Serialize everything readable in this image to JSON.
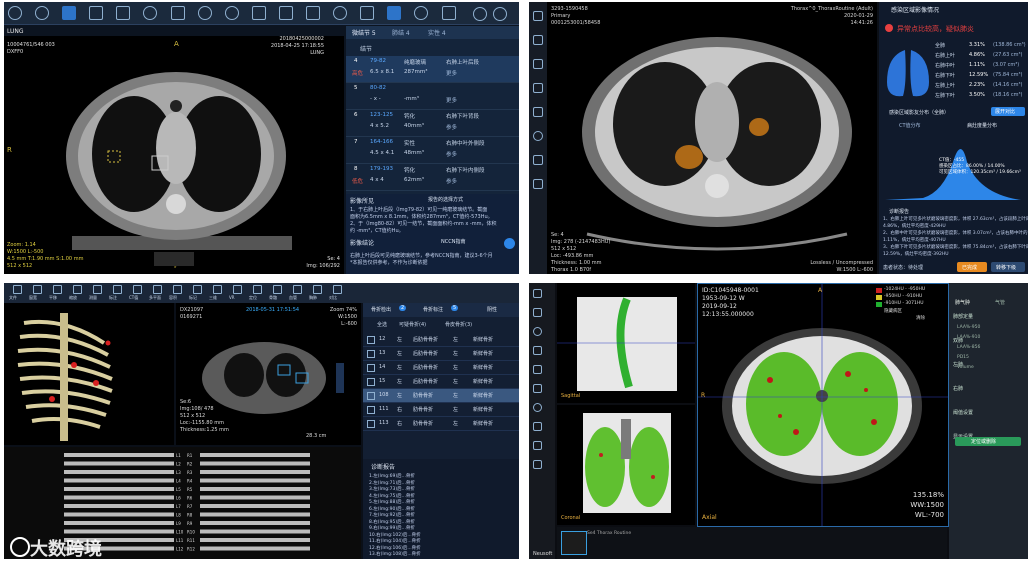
{
  "q1": {
    "patient_name": "LUNG",
    "info_left": [
      "10004761/546 003",
      "DXFF0"
    ],
    "info_right": [
      "20180425000002",
      "2018-04-25 17:18:55",
      "LUNG"
    ],
    "view_label_a": "A",
    "view_label_p": "P",
    "view_label_r": "R",
    "bottom_left": [
      "Zoom: 1.14",
      "W:1500 L:-500",
      "4.5 mm T:1.90 mm S:1.00 mm",
      "512 x 512"
    ],
    "bottom_right": [
      "Se: 4",
      "Img: 106/292"
    ],
    "tabs": [
      "微结节 5",
      "肺结 4",
      "实性 4"
    ],
    "list_header": "结节",
    "rows": [
      {
        "id": "4",
        "im": "79-82",
        "type": "纯磨玻璃",
        "loc": "右肺上叶后段",
        "size": "6.5 x 8.1",
        "vol": "287mm³",
        "risk": "高危",
        "more": "更多"
      },
      {
        "id": "5",
        "im": "80-82",
        "type": "",
        "loc": "",
        "size": "- x -",
        "vol": "-mm³",
        "risk": "",
        "more": "更多"
      },
      {
        "id": "6",
        "im": "123-125",
        "type": "钙化",
        "loc": "右肺下叶背段",
        "size": "4 x 5.2",
        "vol": "40mm³",
        "risk": "",
        "more": "参多"
      },
      {
        "id": "7",
        "im": "164-166",
        "type": "实性",
        "loc": "右肺中叶外侧段",
        "size": "4.5 x 4.1",
        "vol": "48mm³",
        "risk": "",
        "more": "参多"
      },
      {
        "id": "8",
        "im": "179-193",
        "type": "钙化",
        "loc": "右肺下叶内侧段",
        "size": "4 x 4",
        "vol": "62mm³",
        "risk": "低危",
        "more": "参多"
      }
    ],
    "report_title": "影像所见",
    "report_mode": "报告的选择方式",
    "report_text": [
      "1、于右肺上叶后段（Img79-82）可见一纯磨玻璃结节。截面",
      "面积为6.5mm x 8.1mm，体积约287mm³，CT值约-573Hu。",
      "2、于（Img80-82）可见一结节，截面面积约-mm x -mm，体积",
      "约 -mm³，CT值约Hu。"
    ],
    "conclusion_title": "影像结论",
    "conclusion_mode": "NCCN指南",
    "conclusion_text": [
      "右肺上叶后段可见纯磨玻璃结节，参考NCCN指南，建议3-6个月",
      "*本报告仅供参考，不作为诊断依据"
    ]
  },
  "q2": {
    "tl": [
      "3293-1590458",
      "Primary",
      "0001253001/58458"
    ],
    "tr": [
      "Thorax^0_ThoraxRoutine (Adult)",
      "2020-01-29",
      "14:41:26"
    ],
    "bl": [
      "Se: 4",
      "Img: 278 (-2147483HU)",
      "512 x 512",
      "Loc: -493.86 mm",
      "Thickness: 1.00 mm",
      "Thorax 1.0 B70f"
    ],
    "br": [
      "Lossless / Uncompressed",
      "W:1500 L:-600"
    ],
    "panel_title": "感染区域影像情况",
    "alert": "异常点比较高，疑似肺炎",
    "lobes": [
      {
        "name": "全肺",
        "pct": "3.31%",
        "vol": "(138.86 cm³)"
      },
      {
        "name": "右肺上叶",
        "pct": "4.86%",
        "vol": "(27.63 cm³)"
      },
      {
        "name": "右肺中叶",
        "pct": "1.11%",
        "vol": "(3.07 cm³)"
      },
      {
        "name": "右肺下叶",
        "pct": "12.59%",
        "vol": "(75.84 cm³)"
      },
      {
        "name": "左肺上叶",
        "pct": "2.23%",
        "vol": "(14.16 cm³)"
      },
      {
        "name": "左肺下叶",
        "pct": "3.50%",
        "vol": "(18.16 cm³)"
      }
    ],
    "dist_title": "感染区域影友分布（全肺）",
    "dist_btn": "展开对比",
    "tab1": "CT值分布",
    "tab2": "病灶度量分布",
    "tooltip": [
      "CT值：-455",
      "感染区占比：86.00% / 14.00%",
      "可见区域体积：120.35cm³ / 19.66cm³"
    ],
    "report_title": "诊断报告",
    "report": [
      "1、右肺上叶可见多片状磨玻璃密度影，体积 27.63cm³，占该段肺上叶的",
      "4.86%，病灶平均密度-429HU",
      "2、右肺中叶可见多片状磨玻璃密度影，体积 3.07cm³，占该右肺中叶的",
      "1.11%，病灶平均密度-407HU",
      "3、右肺下叶可见多片状磨玻璃密度影，体积 75.84cm³，占该右肺下叶的",
      "12.59%，病灶平均密度-392HU"
    ],
    "diag": "患者状态：待处理",
    "btn_ok": "已完成",
    "btn_next": "转移下级"
  },
  "q3": {
    "toolbar": [
      "文件",
      "窗宽",
      "平移",
      "缩放",
      "测量",
      "标注",
      "CT值",
      "多平面",
      "容积",
      "标记",
      "三维",
      "VR",
      "定位",
      "骨骼",
      "血管",
      "胸肺",
      "对比"
    ],
    "info": [
      "DX21097",
      "0169271",
      "2018-05-31 17:51:54",
      "Zoom 74%",
      "W:1500",
      "L:-600"
    ],
    "info_bl": [
      "Se:6",
      "Img:108/ 478",
      "512 x 512",
      "Loc:-1155.80 mm",
      "Thickness:1.25 mm"
    ],
    "scale": "28.3 cm",
    "panel_tab1": "骨折检出",
    "panel_tab1_count": "2",
    "panel_tab2": "骨折标注",
    "panel_tab2_count": "5",
    "panel_tab3": "阴性",
    "filter": [
      "全选",
      "可疑骨折(4)",
      "骨皮骨折(3)"
    ],
    "rows": [
      {
        "n": "12",
        "side": "左",
        "loc": "后肋骨骨折",
        "type": "左",
        "grade": "新鲜骨折",
        "hl": false
      },
      {
        "n": "13",
        "side": "左",
        "loc": "后肋骨骨折",
        "type": "左",
        "grade": "新鲜骨折",
        "hl": false
      },
      {
        "n": "14",
        "side": "左",
        "loc": "后肋骨骨折",
        "type": "左",
        "grade": "新鲜骨折",
        "hl": false
      },
      {
        "n": "15",
        "side": "左",
        "loc": "后肋骨骨折",
        "type": "左",
        "grade": "新鲜骨折",
        "hl": false
      },
      {
        "n": "108",
        "side": "左",
        "loc": "肋骨骨折",
        "type": "左",
        "grade": "新鲜骨折",
        "hl": true
      },
      {
        "n": "111",
        "side": "右",
        "loc": "肋骨骨折",
        "type": "左",
        "grade": "新鲜骨折",
        "hl": false
      },
      {
        "n": "113",
        "side": "右",
        "loc": "肋骨骨折",
        "type": "左",
        "grade": "新鲜骨折",
        "hl": false
      }
    ],
    "report_title": "诊断报告",
    "report_lines": [
      "1.左(Img:69)后...骨折",
      "2.左(Img:71)后...骨折",
      "3.左(Img:73)后...骨折",
      "4.左(Img:75)后...骨折",
      "5.左(Img:88)后...骨折",
      "6.左(Img:90)后...骨折",
      "7.左(Img:92)后...骨折",
      "8.右(Img:95)后...骨折",
      "9.右(Img:99)后...骨折",
      "10.右(Img:102)后...骨折",
      "11.右(Img:104)后...骨折",
      "12.右(Img:106)后...骨折",
      "13.右(Img:108)后...骨折"
    ],
    "watermark": "大数跨境",
    "rib_labels_l": [
      "L1",
      "L2",
      "L3",
      "L4",
      "L5",
      "L6",
      "L7",
      "L8",
      "L9",
      "L10",
      "L11",
      "L12"
    ],
    "rib_labels_r": [
      "R1",
      "R2",
      "R3",
      "R4",
      "R5",
      "R6",
      "R7",
      "R8",
      "R9",
      "R10",
      "R11",
      "R12"
    ]
  },
  "q4": {
    "id": "ID:C1045948-0001",
    "dob": "1953-09-12 W",
    "date": "2019-09-12",
    "time": "12:13:55.000000",
    "legend": [
      {
        "label": "-1024HU - -950HU",
        "color": "#cc2020"
      },
      {
        "label": "-950HU - -910HU",
        "color": "#d8c828"
      },
      {
        "label": "-910HU - 3071HU",
        "color": "#20b030"
      }
    ],
    "legend_toggle": "隐藏病区",
    "legend_toggle2": "清除",
    "zoom": "135.18%",
    "ww": "WW:1500",
    "wl": "WL:-700",
    "axial": "Axial",
    "sagittal": "Sagittal",
    "coronal": "Coronal",
    "label_a": "A",
    "label_r": "R",
    "label_s": "S",
    "label_l": "L",
    "series_label": "Neusoft",
    "thumb": "Se4 Thorax Routine",
    "right_tab1": "肺气肿",
    "right_tab2": "气管",
    "right_sections": [
      "肺部定量",
      "双肺",
      "左肺",
      "右肺",
      "阈值设置",
      "显示设置"
    ],
    "right_btn": "定位或删除",
    "right_rows": [
      "LAA%-950",
      "LAA%-910",
      "LAA%-856",
      "PD15",
      "Volume"
    ]
  }
}
